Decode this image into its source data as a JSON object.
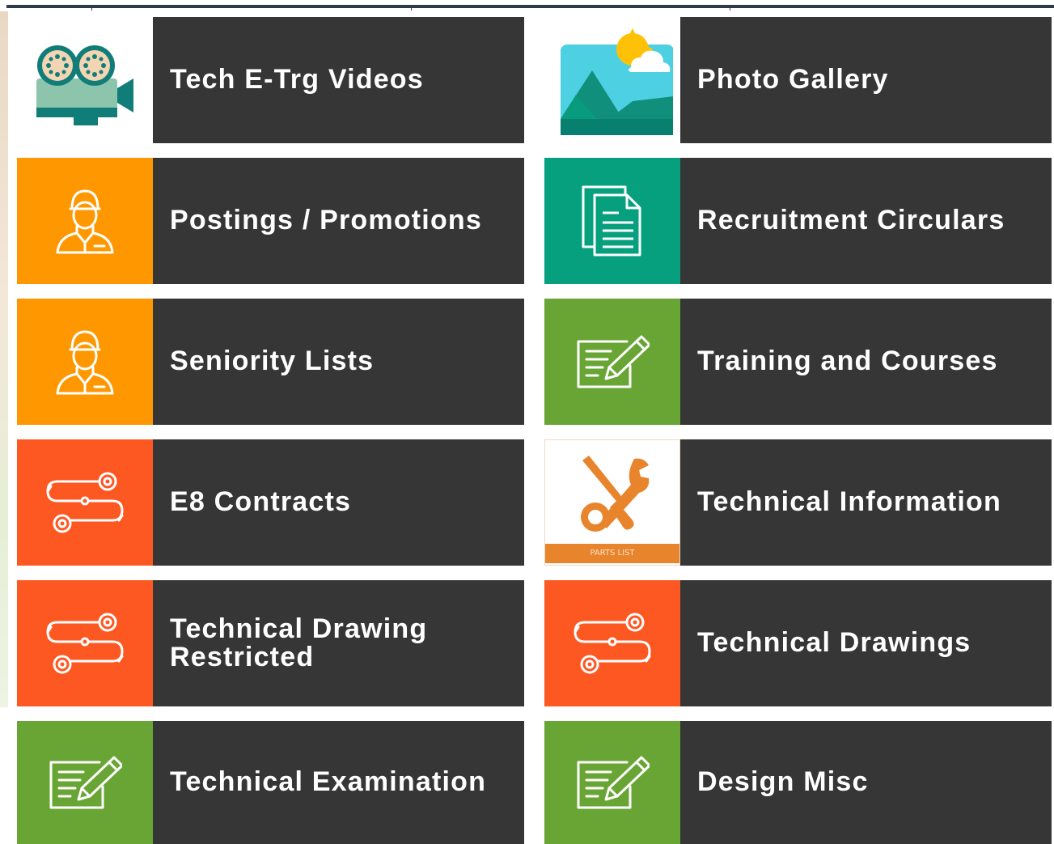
{
  "colors": {
    "label_bg": "#363636",
    "orange": "#ff9800",
    "teal": "#07a07e",
    "green": "#69a534",
    "red_orange": "#fd5722",
    "white": "#ffffff",
    "tools_orange": "#e8842b"
  },
  "tiles": [
    {
      "label": "Tech E-Trg Videos",
      "icon": "video-camera-icon",
      "icon_bg": "#ffffff"
    },
    {
      "label": "Photo Gallery",
      "icon": "photo-gallery-icon",
      "icon_bg": "#ffffff"
    },
    {
      "label": "Postings / Promotions",
      "icon": "person-icon",
      "icon_bg": "#ff9800"
    },
    {
      "label": "Recruitment Circulars",
      "icon": "document-icon",
      "icon_bg": "#07a07e"
    },
    {
      "label": "Seniority Lists",
      "icon": "person-icon",
      "icon_bg": "#ff9800"
    },
    {
      "label": "Training and Courses",
      "icon": "edit-note-icon",
      "icon_bg": "#69a534"
    },
    {
      "label": "E8 Contracts",
      "icon": "route-icon",
      "icon_bg": "#fd5722"
    },
    {
      "label": "Technical Information",
      "icon": "tools-icon",
      "icon_bg": "#ffffff",
      "icon_caption": "PARTS LIST"
    },
    {
      "label": "Technical Drawing Restricted",
      "icon": "route-icon",
      "icon_bg": "#fd5722"
    },
    {
      "label": "Technical Drawings",
      "icon": "route-icon",
      "icon_bg": "#fd5722"
    },
    {
      "label": "Technical Examination",
      "icon": "edit-note-icon",
      "icon_bg": "#69a534"
    },
    {
      "label": "Design Misc",
      "icon": "edit-note-icon",
      "icon_bg": "#69a534"
    }
  ]
}
